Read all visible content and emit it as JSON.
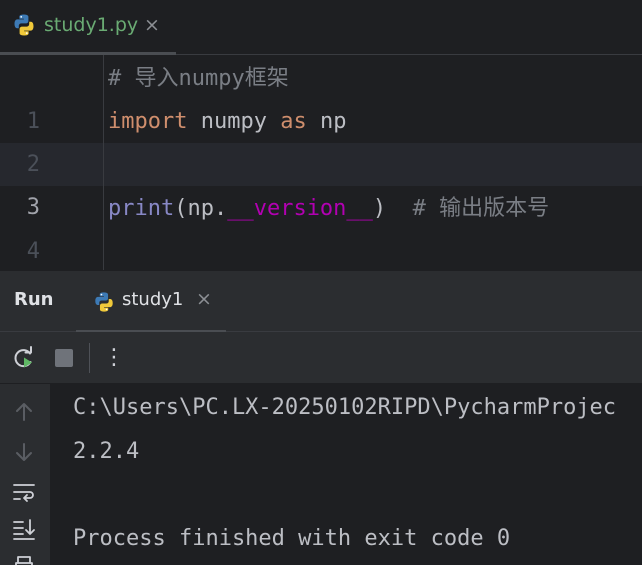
{
  "editor_tab": {
    "filename": "study1.py",
    "close_glyph": "×",
    "icon": "python-icon",
    "label_color": "#6aab73"
  },
  "editor": {
    "lines": [
      {
        "number": "1",
        "comment": "# 导入numpy框架"
      },
      {
        "number": "2",
        "kw1": "import",
        "text1": " numpy ",
        "kw2": "as",
        "text2": " np"
      },
      {
        "number": "3"
      },
      {
        "number": "4",
        "builtin": "print",
        "open": "(np.",
        "dunder": "__version__",
        "close": ")",
        "gap": "  ",
        "comment": "# 输出版本号"
      }
    ]
  },
  "run_panel": {
    "title": "Run",
    "tab_label": "study1",
    "close_glyph": "×",
    "toolbar": {
      "rerun_icon": "rerun-icon",
      "stop_icon": "stop-icon",
      "more_icon": "more-vertical-icon",
      "more_glyph": "⋮"
    },
    "side_icons": [
      "arrow-up-icon",
      "arrow-down-icon",
      "soft-wrap-icon",
      "scroll-to-end-icon",
      "print-icon"
    ]
  },
  "console": {
    "lines": [
      "C:\\Users\\PC.LX-20250102RIPD\\PycharmProjec",
      "2.2.4",
      "",
      "Process finished with exit code 0"
    ]
  }
}
